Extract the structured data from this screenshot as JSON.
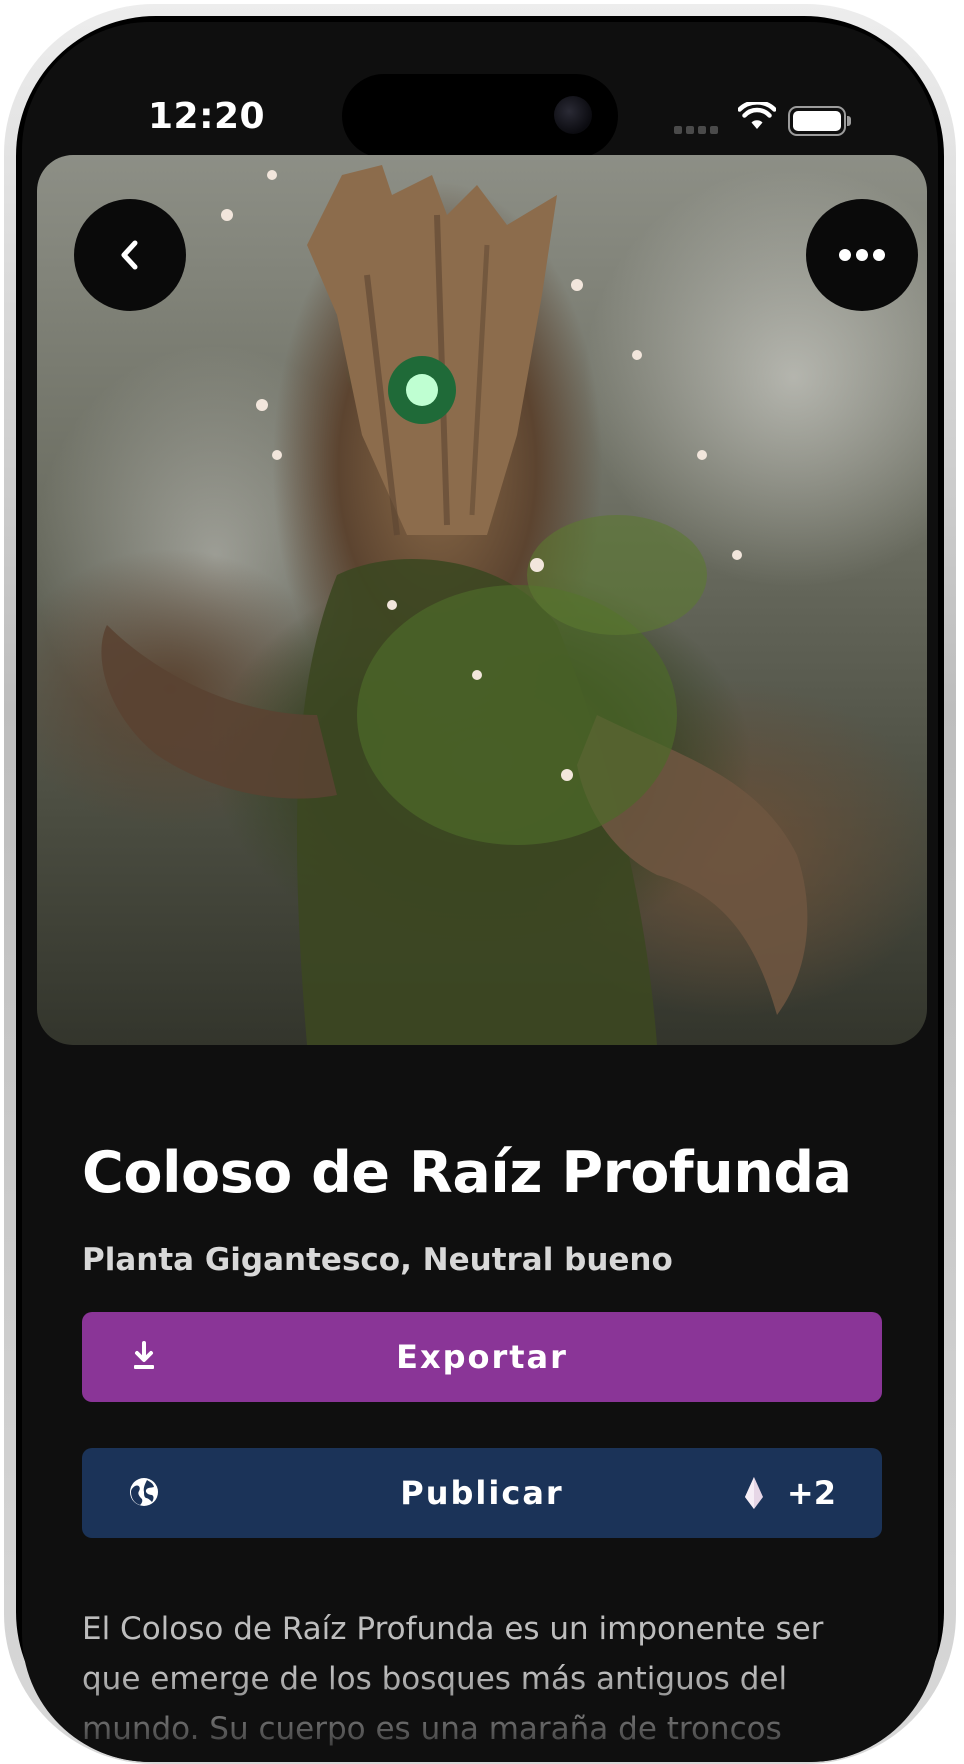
{
  "status_bar": {
    "time": "12:20",
    "icons": [
      "cellular-signal-icon",
      "wifi-icon",
      "battery-icon"
    ]
  },
  "hero": {
    "image_subject": "tree creature",
    "buttons": [
      {
        "name": "back-button",
        "icon": "chevron-left-icon"
      },
      {
        "name": "more-options-button",
        "icon": "more-horizontal-icon"
      }
    ]
  },
  "creature": {
    "name": "Coloso de Raíz Profunda",
    "subtitle": "Planta Gigantesco, Neutral bueno",
    "description": "El Coloso de Raíz Profunda es un imponente ser que emerge de los bosques más antiguos del mundo. Su cuerpo es una maraña de troncos"
  },
  "actions": {
    "export": {
      "label": "Exportar",
      "icon": "download-icon",
      "color": "#8a3597"
    },
    "publish": {
      "label": "Publicar",
      "icon": "globe-icon",
      "credit_icon": "crystal-icon",
      "credit": "+2",
      "color": "#1b3358"
    }
  },
  "colors": {
    "background": "#0f0f0f",
    "title": "#ffffff",
    "subtitle": "#d8d8d8",
    "description": "#bdbdbd"
  }
}
